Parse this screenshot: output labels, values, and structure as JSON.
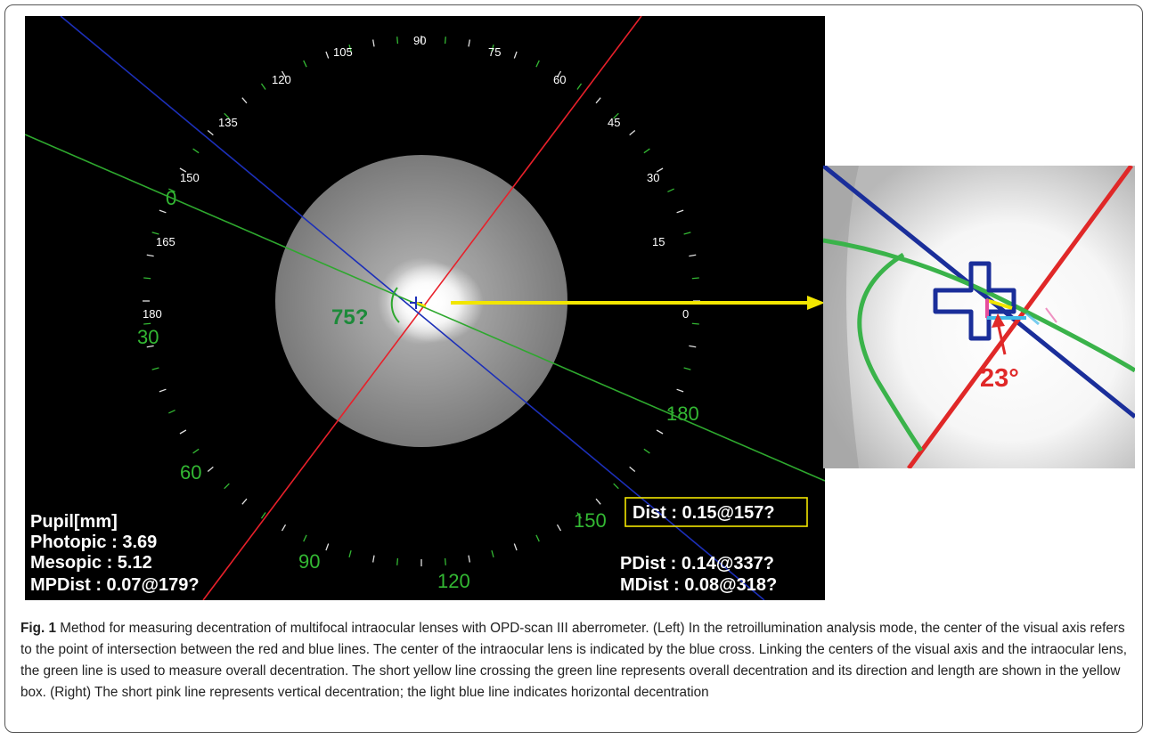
{
  "scan": {
    "angle_labels": [
      "90",
      "75",
      "60",
      "45",
      "30",
      "15",
      "0",
      "105",
      "120",
      "135",
      "150",
      "165",
      "180"
    ],
    "green_labels": [
      "0",
      "30",
      "60",
      "90",
      "120",
      "150",
      "180"
    ],
    "angle_readout": "75?",
    "pupil": {
      "title": "Pupil[mm]",
      "photopic": "Photopic : 3.69",
      "mesopic": "Mesopic : 5.12",
      "mpdist": "MPDist :  0.07@179?"
    },
    "dist_box": "Dist :  0.15@157?",
    "pdist": "PDist :  0.14@337?",
    "mdist": "MDist :  0.08@318?",
    "colors": {
      "red": "#e8202a",
      "blue": "#1c2fb8",
      "green": "#2ea82e",
      "yellow": "#f2e600"
    }
  },
  "zoom": {
    "angle_label": "23°",
    "colors": {
      "red": "#e02828",
      "blue": "#1a2e9a",
      "green": "#3ab34a",
      "pink": "#e64d9c",
      "lightblue": "#3fb8e8"
    }
  },
  "caption": {
    "label": "Fig. 1",
    "text": " Method for measuring decentration of multifocal intraocular lenses with OPD-scan III aberrometer. (Left) In the retroillumination analysis mode, the center of the visual axis refers to the point of intersection between the red and blue lines. The center of the intraocular lens is indicated by the blue cross. Linking the centers of the visual axis and the intraocular lens, the green line is used to measure overall decentration. The short yellow line crossing the green line represents overall decentration and its direction and length are shown in the yellow box. (Right) The short pink line represents vertical decentration; the light blue line indicates horizontal decentration"
  }
}
